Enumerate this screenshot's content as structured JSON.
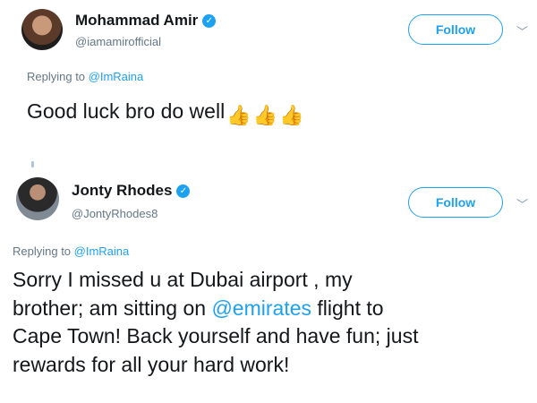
{
  "tweets": [
    {
      "display_name": "Mohammad Amir",
      "handle": "@iamamirofficial",
      "follow_label": "Follow",
      "replying_prefix": "Replying to ",
      "replying_to": "@ImRaina",
      "text": "Good luck bro do well",
      "emoji": [
        "thumbs-up-icon",
        "thumbs-up-icon",
        "thumbs-up-icon"
      ]
    },
    {
      "display_name": "Jonty Rhodes",
      "handle": "@JontyRhodes8",
      "follow_label": "Follow",
      "replying_prefix": "Replying to ",
      "replying_to": "@ImRaina",
      "text_parts": {
        "line1": "Sorry I  missed u at Dubai airport , my",
        "line2_pre": "brother; am sitting on ",
        "mention": "@emirates",
        "line2_post": " flight to",
        "line3": "Cape Town!  Back yourself and have fun; just",
        "line4": "rewards for all your hard work!"
      }
    }
  ],
  "colors": {
    "accent": "#1da1f2",
    "text": "#14171a",
    "muted": "#657786"
  }
}
